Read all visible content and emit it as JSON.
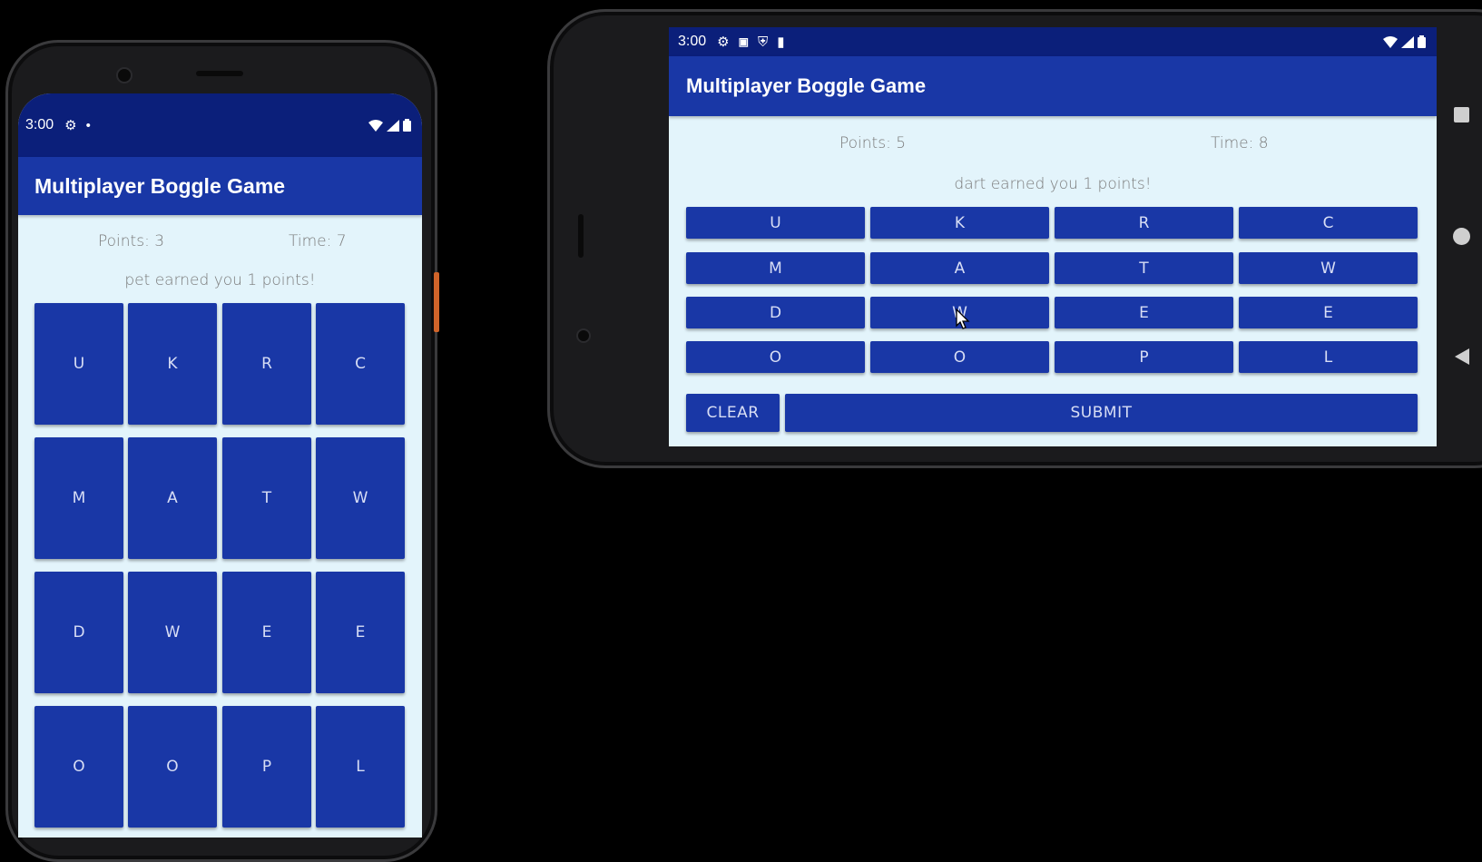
{
  "portrait": {
    "status": {
      "time": "3:00",
      "icons": [
        "gear-icon",
        "dot-icon"
      ],
      "right_icons": [
        "wifi-icon",
        "signal-icon",
        "battery-icon"
      ]
    },
    "app_title": "Multiplayer Boggle Game",
    "points": "Points: 3",
    "time": "Time: 7",
    "message": "pet earned you 1 points!",
    "board": [
      [
        "U",
        "K",
        "R",
        "C"
      ],
      [
        "M",
        "A",
        "T",
        "W"
      ],
      [
        "D",
        "W",
        "E",
        "E"
      ],
      [
        "O",
        "O",
        "P",
        "L"
      ]
    ]
  },
  "landscape": {
    "status": {
      "time": "3:00",
      "icons": [
        "gear-icon",
        "a-icon",
        "shield-icon",
        "sd-card-icon"
      ],
      "right_icons": [
        "wifi-icon",
        "signal-icon",
        "battery-icon"
      ]
    },
    "app_title": "Multiplayer Boggle Game",
    "points": "Points: 5",
    "time": "Time: 8",
    "message": "dart earned you 1 points!",
    "board": [
      [
        "U",
        "K",
        "R",
        "C"
      ],
      [
        "M",
        "A",
        "T",
        "W"
      ],
      [
        "D",
        "W",
        "E",
        "E"
      ],
      [
        "O",
        "O",
        "P",
        "L"
      ]
    ],
    "clear_label": "CLEAR",
    "submit_label": "SUBMIT",
    "nav_icons": [
      "recents-icon",
      "home-icon",
      "back-icon"
    ]
  },
  "colors": {
    "tile": "#1937a6",
    "status_bar": "#0b1f7a",
    "background": "#e3f4fb"
  }
}
